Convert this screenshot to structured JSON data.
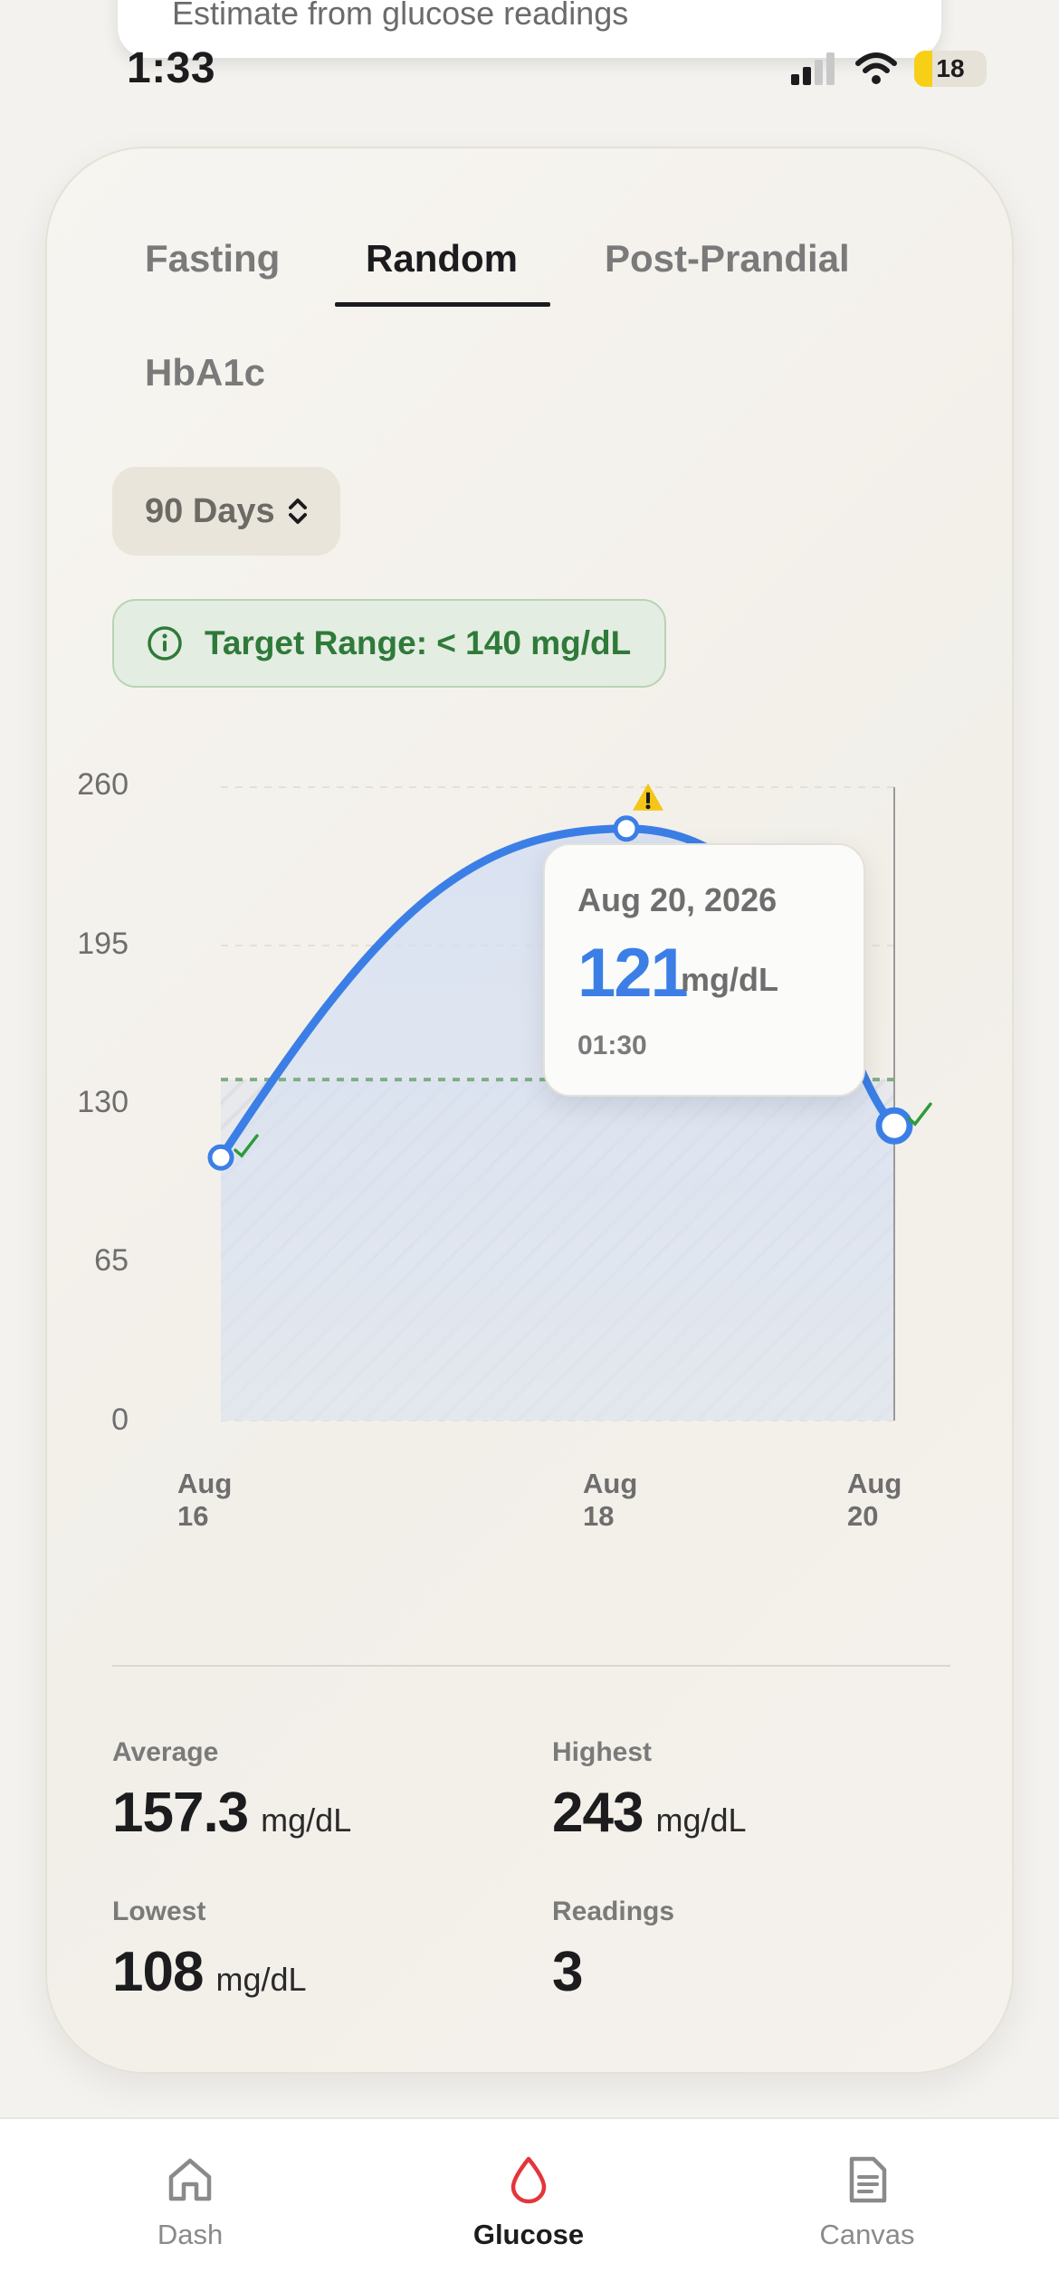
{
  "popover_text": "Estimate from glucose readings",
  "status": {
    "time": "1:33",
    "battery": "18"
  },
  "tabs": [
    {
      "label": "Fasting",
      "active": false
    },
    {
      "label": "Random",
      "active": true
    },
    {
      "label": "Post-Prandial",
      "active": false
    },
    {
      "label": "HbA1c",
      "active": false
    }
  ],
  "range_select": {
    "value": "90 Days"
  },
  "target": {
    "label": "Target Range: < 140 mg/dL",
    "threshold": 140
  },
  "chart_data": {
    "type": "line",
    "x": [
      "Aug 16",
      "Aug 18",
      "Aug 20"
    ],
    "series": [
      {
        "values": [
          108,
          243,
          121
        ]
      }
    ],
    "ylim": [
      0,
      260
    ],
    "yticks": [
      0,
      65,
      130,
      195,
      260
    ],
    "target_line": 140,
    "grid": true
  },
  "tooltip": {
    "date": "Aug 20, 2026",
    "value": "121",
    "unit": "mg/dL",
    "time": "01:30"
  },
  "stats": {
    "average": {
      "label": "Average",
      "value": "157.3",
      "unit": "mg/dL"
    },
    "highest": {
      "label": "Highest",
      "value": "243",
      "unit": "mg/dL"
    },
    "lowest": {
      "label": "Lowest",
      "value": "108",
      "unit": "mg/dL"
    },
    "readings": {
      "label": "Readings",
      "value": "3"
    }
  },
  "colors": {
    "accent": "#3b7fe6",
    "target": "#2f7a3a",
    "warning": "#f5c518",
    "active_nav": "#e5353c"
  },
  "nav": [
    {
      "label": "Dash",
      "icon": "home-icon",
      "active": false
    },
    {
      "label": "Glucose",
      "icon": "drop-icon",
      "active": true
    },
    {
      "label": "Canvas",
      "icon": "document-icon",
      "active": false
    }
  ]
}
